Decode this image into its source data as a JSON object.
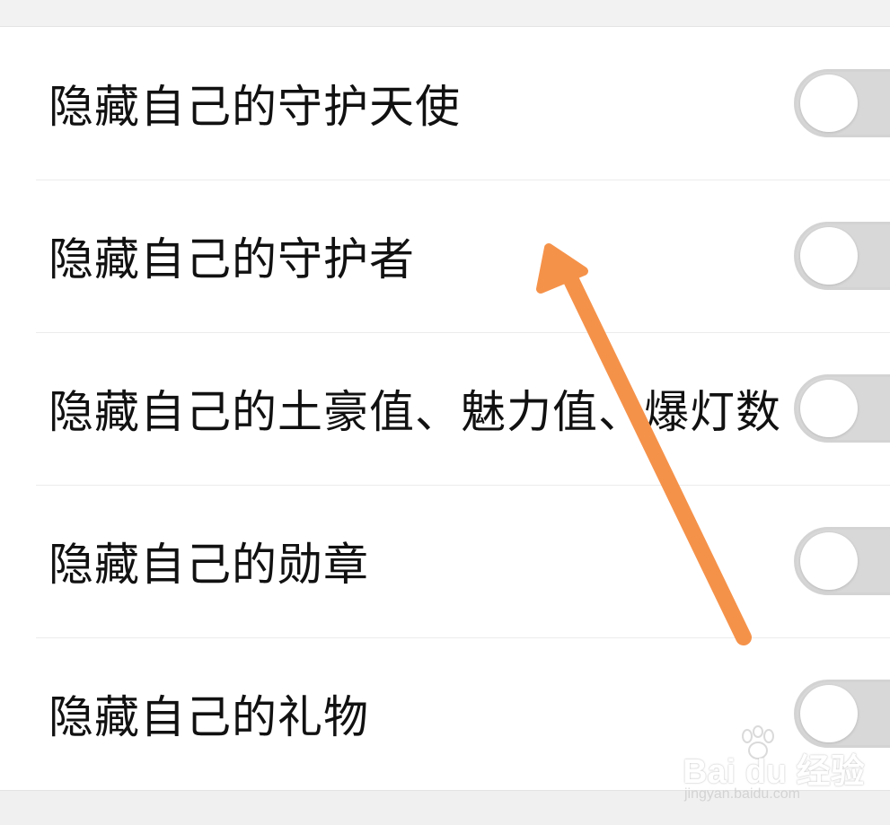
{
  "settings": {
    "items": [
      {
        "label": "隐藏自己的守护天使",
        "toggle_on": false
      },
      {
        "label": "隐藏自己的守护者",
        "toggle_on": false
      },
      {
        "label": "隐藏自己的土豪值、魅力值、爆灯数",
        "toggle_on": false
      },
      {
        "label": "隐藏自己的勋章",
        "toggle_on": false
      },
      {
        "label": "隐藏自己的礼物",
        "toggle_on": false
      }
    ]
  },
  "annotation": {
    "icon": "arrow-icon",
    "color": "#f5924a"
  },
  "watermark": {
    "logo_text": "Bai du 经验",
    "url_text": "jingyan.baidu.com"
  },
  "colors": {
    "toggle_off": "#d8d8d8",
    "background": "#f0f0f0",
    "panel": "#ffffff"
  }
}
